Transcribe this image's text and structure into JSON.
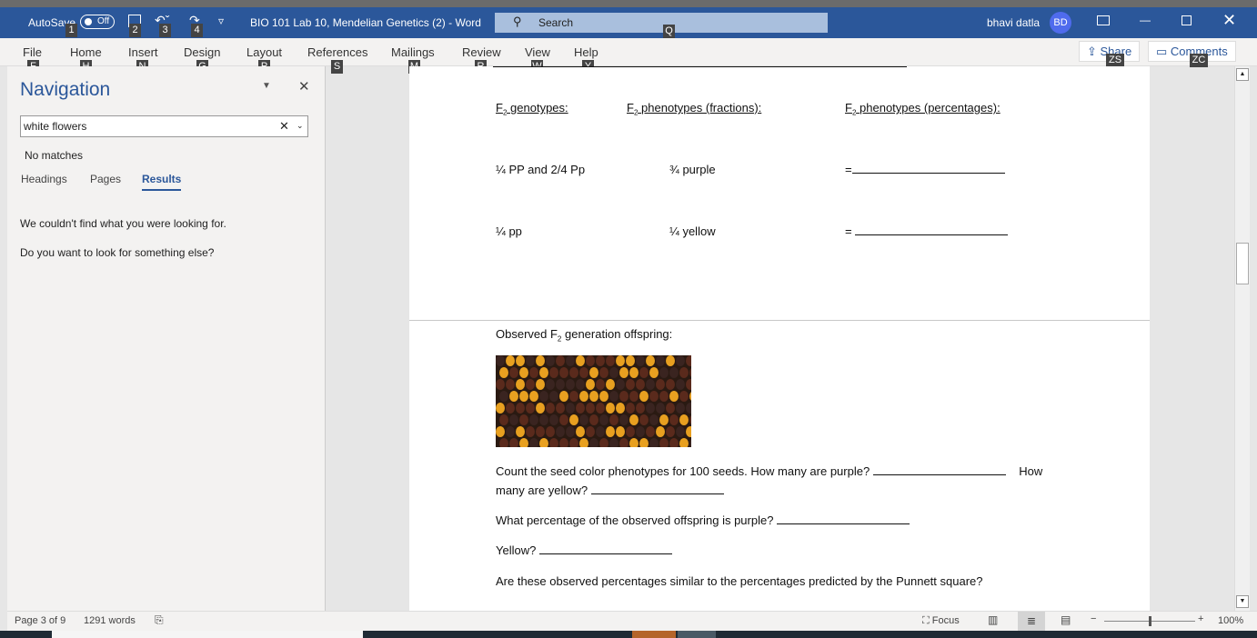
{
  "titlebar": {
    "autosave": "AutoSave",
    "autosave_state": "Off",
    "doc_title": "BIO 101 Lab 10, Mendelian Genetics (2)  -  Word",
    "search": "Search",
    "user": "bhavi datla",
    "avatar": "BD",
    "keytips": [
      "1",
      "2",
      "3",
      "4",
      "Q"
    ]
  },
  "ribbon": {
    "tabs": [
      {
        "label": "File",
        "key": "F"
      },
      {
        "label": "Home",
        "key": "H"
      },
      {
        "label": "Insert",
        "key": "N"
      },
      {
        "label": "Design",
        "key": "G"
      },
      {
        "label": "Layout",
        "key": "P"
      },
      {
        "label": "References",
        "key": "S"
      },
      {
        "label": "Mailings",
        "key": "M"
      },
      {
        "label": "Review",
        "key": "R"
      },
      {
        "label": "View",
        "key": "W"
      },
      {
        "label": "Help",
        "key": "Y"
      }
    ],
    "share": "Share",
    "share_key": "ZS",
    "comments": "Comments",
    "comments_key": "ZC"
  },
  "nav": {
    "title": "Navigation",
    "search_value": "white flowers",
    "no_matches": "No matches",
    "tabs": [
      "Headings",
      "Pages",
      "Results"
    ],
    "active_tab": "Results",
    "msg1": "We couldn't find what you were looking for.",
    "msg2": "Do you want to look for something else?"
  },
  "doc": {
    "h1": "F",
    "h1b": "genotypes:",
    "h2": "F",
    "h2b": "phenotypes (fractions):",
    "h3": "F",
    "h3b": "phenotypes (percentages):",
    "sub": "2",
    "r1a": "¼ PP and 2/4 Pp",
    "r1b": "¾ purple",
    "r1c": "=",
    "r2a": "¼ pp",
    "r2b": "¼ yellow",
    "r2c": "= ",
    "obs_a": "Observed F",
    "obs_b": " generation offspring:",
    "q1a": "Count the seed color phenotypes for 100 seeds.  How many are purple?",
    "q1b": "How",
    "q1c": "many are yellow?",
    "q2": "What percentage of the observed offspring is purple?",
    "q3": "Yellow?",
    "q4": "Are these observed percentages similar to the percentages predicted by the Punnett square?"
  },
  "status": {
    "page": "Page 3 of 9",
    "words": "1291 words",
    "focus": "Focus",
    "zoom": "100%",
    "zoom_level": 100
  },
  "colors": {
    "accent": "#2b579a",
    "avatar": "#4f6bed"
  }
}
